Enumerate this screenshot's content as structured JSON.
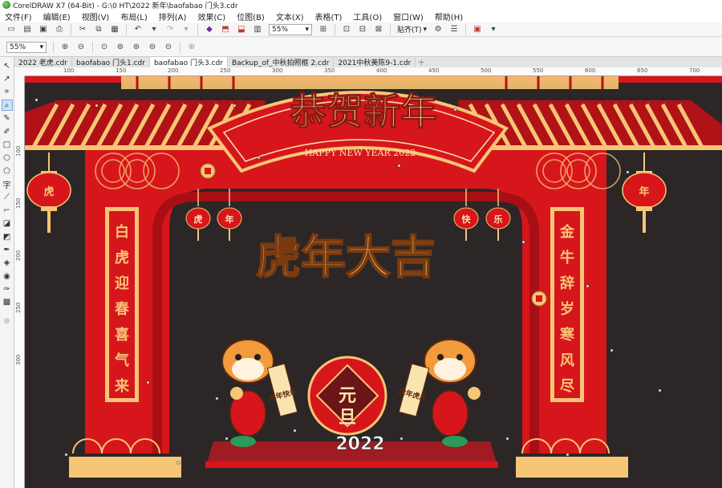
{
  "window": {
    "title": "CorelDRAW X7 (64-Bit) - G:\\0 HT\\2022 新年\\baofabao 门头3.cdr"
  },
  "menu": [
    "文件(F)",
    "编辑(E)",
    "视图(V)",
    "布局(L)",
    "排列(A)",
    "效果(C)",
    "位图(B)",
    "文本(X)",
    "表格(T)",
    "工具(O)",
    "窗口(W)",
    "帮助(H)"
  ],
  "toolbar": {
    "zoom": "55%",
    "snap_label": "贴齐(T)"
  },
  "propbar": {
    "zoom": "55%"
  },
  "tabs": [
    {
      "label": "2022 老虎.cdr",
      "active": false
    },
    {
      "label": "baofabao 门头1.cdr",
      "active": false
    },
    {
      "label": "baofabao 门头3.cdr",
      "active": true
    },
    {
      "label": "Backup_of_中秋拍照框 2.cdr",
      "active": false
    },
    {
      "label": "2021中秋美陈9-1.cdr",
      "active": false
    }
  ],
  "hruler_labels": [
    "100",
    "150",
    "200",
    "250",
    "300",
    "350",
    "400",
    "450",
    "500",
    "550",
    "600",
    "650",
    "700"
  ],
  "vruler_labels": [
    "100",
    "150",
    "200",
    "250",
    "300"
  ],
  "artwork": {
    "banner_title": "恭贺新年",
    "banner_subtitle": "HAPPY NEW YEAR 2022",
    "center_slogan": "虎年大吉",
    "left_couplet": [
      "白",
      "虎",
      "迎",
      "春",
      "喜",
      "气",
      "来"
    ],
    "right_couplet": [
      "金",
      "牛",
      "辞",
      "岁",
      "寒",
      "风",
      "尽"
    ],
    "lanterns": [
      "虎",
      "年",
      "快",
      "乐"
    ],
    "side_lantern_left": "虎",
    "side_lantern_right": "年",
    "medallion": [
      "元",
      "旦"
    ],
    "year": "2022",
    "scroll_left": "虎年快乐",
    "scroll_right": "虎年虎风"
  },
  "colors": {
    "canvas_bg": "#2c2726",
    "red": "#d7161c",
    "dark_red": "#9e0f13",
    "gold": "#f6c676",
    "cream": "#fbe3b0"
  }
}
